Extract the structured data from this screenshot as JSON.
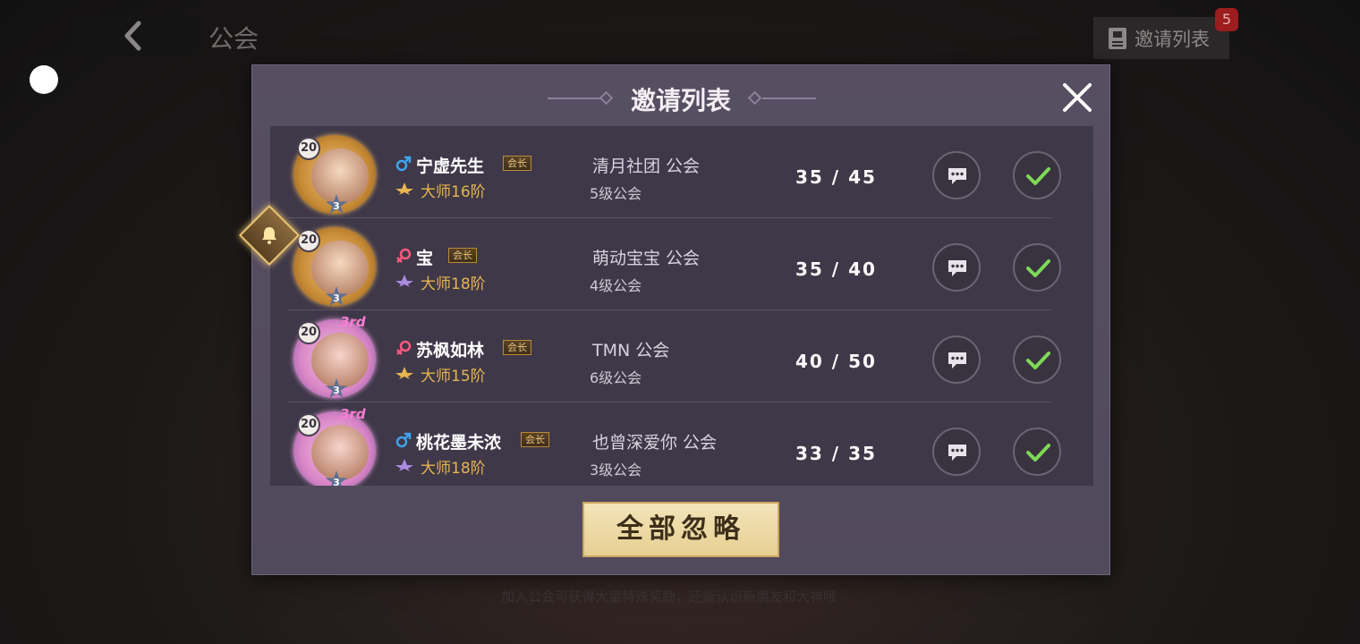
{
  "header": {
    "title": "公会",
    "invite_button_label": "邀请列表",
    "invite_badge_count": "5"
  },
  "footer_hint": "加入公会可获得大量特殊奖励，还能认识新朋友和大神哦",
  "modal": {
    "title": "邀请列表",
    "ignore_all_label": "全部忽略",
    "invites": [
      {
        "level": "20",
        "stars": "3",
        "gender": "male",
        "name": "宁虚先生",
        "leader_tag": "会长",
        "rank": "大师16阶",
        "guild": "清月社团 公会",
        "guild_level": "5级公会",
        "members": "35 / 45",
        "frame": "gold"
      },
      {
        "level": "20",
        "stars": "3",
        "gender": "female",
        "name": "宝",
        "leader_tag": "会长",
        "rank": "大师18阶",
        "guild": "萌动宝宝 公会",
        "guild_level": "4级公会",
        "members": "35 / 40",
        "frame": "gold"
      },
      {
        "level": "20",
        "stars": "3",
        "gender": "female",
        "name": "苏枫如林",
        "leader_tag": "会长",
        "rank": "大师15阶",
        "guild": "TMN 公会",
        "guild_level": "6级公会",
        "members": "40 / 50",
        "frame": "pink",
        "ribbon": "3rd"
      },
      {
        "level": "20",
        "stars": "3",
        "gender": "male",
        "name": "桃花墨未浓",
        "leader_tag": "会长",
        "rank": "大师18阶",
        "guild": "也曾深爱你 公会",
        "guild_level": "3级公会",
        "members": "33 / 35",
        "frame": "pink",
        "ribbon": "3rd"
      }
    ]
  },
  "colors": {
    "modal_bg": "#574e62",
    "list_bg": "#3f3849",
    "rank_gold": "#e6b54f",
    "accept_green": "#7ed957",
    "male_blue": "#3fa4ee",
    "female_pink": "#ff5a7e"
  }
}
